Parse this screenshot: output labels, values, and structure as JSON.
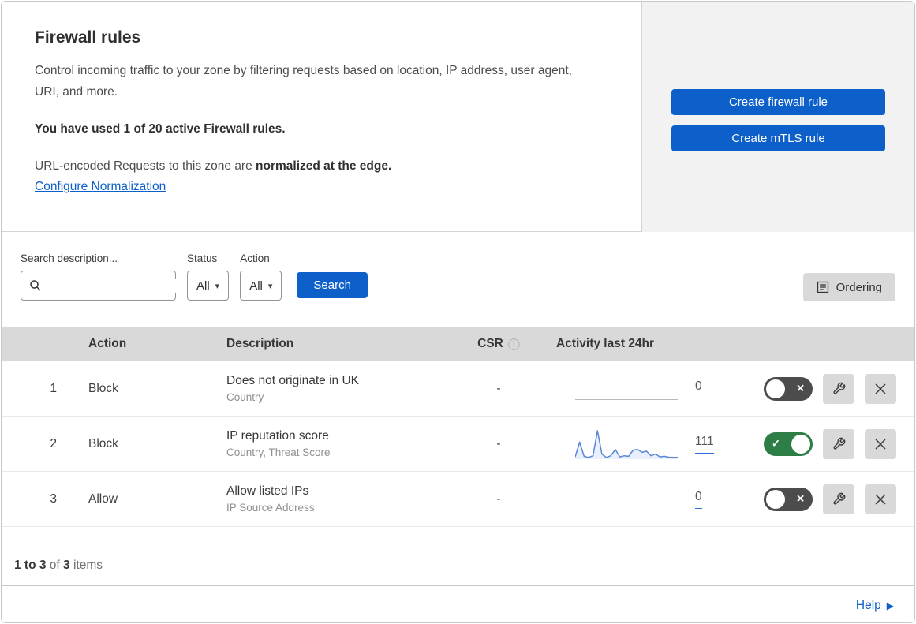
{
  "header": {
    "title": "Firewall rules",
    "description": "Control incoming traffic to your zone by filtering requests based on location, IP address, user agent, URI, and more.",
    "usage": "You have used 1 of 20 active Firewall rules.",
    "normalization_text": "URL-encoded Requests to this zone are ",
    "normalization_bold": "normalized at the edge.",
    "normalization_link": "Configure Normalization",
    "create_firewall_rule_label": "Create firewall rule",
    "create_mtls_rule_label": "Create mTLS rule"
  },
  "filters": {
    "search_label": "Search description...",
    "status_label": "Status",
    "status_value": "All",
    "action_label": "Action",
    "action_value": "All",
    "search_button_label": "Search",
    "ordering_button_label": "Ordering"
  },
  "table": {
    "headers": {
      "action": "Action",
      "description": "Description",
      "csr": "CSR",
      "activity": "Activity last 24hr"
    },
    "rows": [
      {
        "index": "1",
        "action": "Block",
        "description": "Does not originate in UK",
        "fields": "Country",
        "csr": "-",
        "activity_count": "0",
        "enabled": false
      },
      {
        "index": "2",
        "action": "Block",
        "description": "IP reputation score",
        "fields": "Country, Threat Score",
        "csr": "-",
        "activity_count": "111",
        "enabled": true,
        "sparkline": [
          8,
          60,
          10,
          6,
          12,
          100,
          18,
          6,
          12,
          34,
          8,
          12,
          10,
          32,
          34,
          24,
          28,
          12,
          18,
          8,
          10,
          7,
          6,
          6
        ]
      },
      {
        "index": "3",
        "action": "Allow",
        "description": "Allow listed IPs",
        "fields": "IP Source Address",
        "csr": "-",
        "activity_count": "0",
        "enabled": false
      }
    ]
  },
  "footer": {
    "range": "1 to 3",
    "of_label": "of",
    "total": "3",
    "items_label": "items",
    "help_label": "Help"
  },
  "icons": {
    "search": "magnifier",
    "dropdown_caret": "filled-down-triangle",
    "ordering": "document-list",
    "csr_info": "circled-i",
    "toggle_off": "x-mark",
    "toggle_on": "check-mark",
    "edit": "wrench",
    "delete": "x-mark",
    "help": "right-triangle"
  },
  "colors": {
    "accent_blue": "#0d5fc9",
    "toggle_on_green": "#2d7e46",
    "toggle_off_gray": "#4c4c4c",
    "sparkline_blue": "#5b87d7",
    "panel_gray": "#f2f2f2",
    "header_gray": "#d9d9d9"
  }
}
